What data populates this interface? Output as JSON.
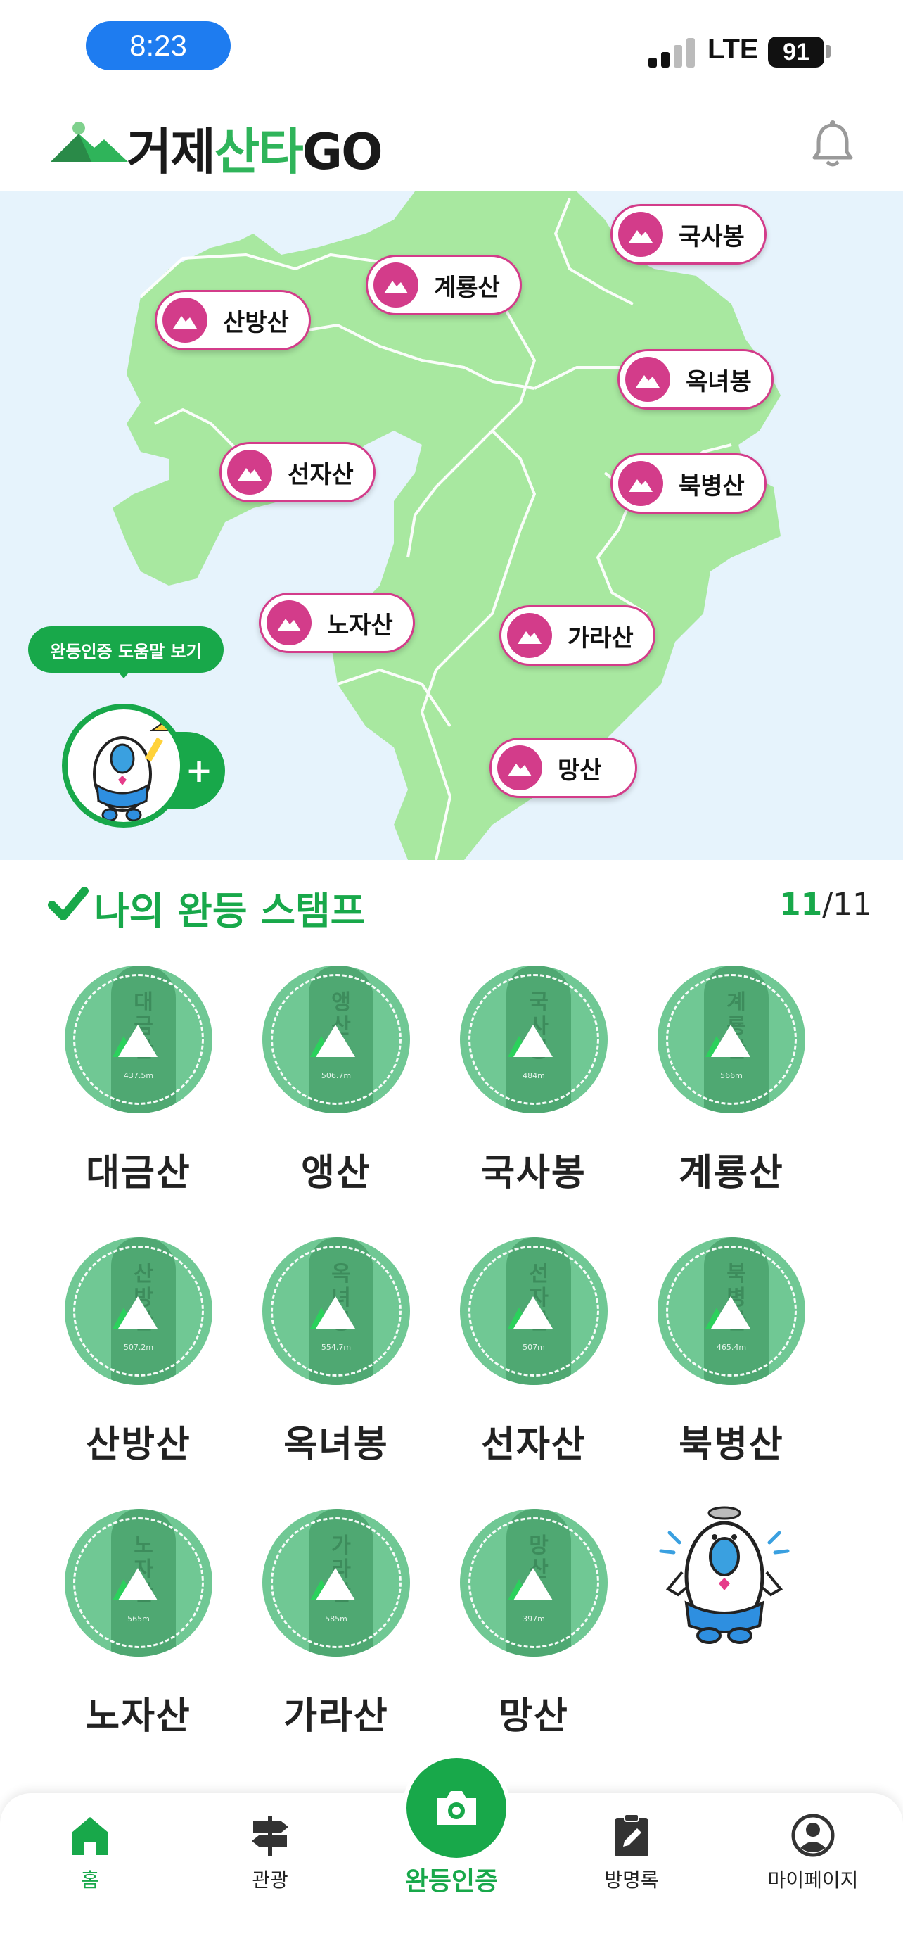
{
  "status_bar": {
    "time": "8:23",
    "network": "LTE",
    "battery": "91"
  },
  "header": {
    "logo_part1": "거제",
    "logo_part2": "산타",
    "logo_part3": "GO"
  },
  "map": {
    "pins": [
      {
        "label": "국사봉"
      },
      {
        "label": "계룡산"
      },
      {
        "label": "산방산"
      },
      {
        "label": "옥녀봉"
      },
      {
        "label": "선자산"
      },
      {
        "label": "북병산"
      },
      {
        "label": "노자산"
      },
      {
        "label": "가라산"
      },
      {
        "label": "망산"
      }
    ],
    "help_text": "완등인증 도움말 보기",
    "plus": "+"
  },
  "stamps": {
    "title": "나의 완등 스탬프",
    "completed": "11",
    "total": "/11",
    "items": [
      {
        "name": "대금산",
        "rock_text": "대금산",
        "height": "437.5m"
      },
      {
        "name": "앵산",
        "rock_text": "앵산",
        "height": "506.7m"
      },
      {
        "name": "국사봉",
        "rock_text": "국사봉",
        "height": "484m"
      },
      {
        "name": "계룡산",
        "rock_text": "계룡산",
        "height": "566m"
      },
      {
        "name": "산방산",
        "rock_text": "산방산",
        "height": "507.2m"
      },
      {
        "name": "옥녀봉",
        "rock_text": "옥녀봉",
        "height": "554.7m"
      },
      {
        "name": "선자산",
        "rock_text": "선자산",
        "height": "507m"
      },
      {
        "name": "북병산",
        "rock_text": "북병산",
        "height": "465.4m"
      },
      {
        "name": "노자산",
        "rock_text": "노자산",
        "height": "565m"
      },
      {
        "name": "가라산",
        "rock_text": "가라산",
        "height": "585m"
      },
      {
        "name": "망산",
        "rock_text": "망산",
        "height": "397m"
      }
    ]
  },
  "nav": {
    "home": "홈",
    "tour": "관광",
    "certify": "완등인증",
    "guestbook": "방명록",
    "mypage": "마이페이지"
  },
  "colors": {
    "brand_green": "#18a84a",
    "pin_magenta": "#d33c8a",
    "map_land": "#a8e8a0",
    "map_sea": "#e6f3fc"
  }
}
